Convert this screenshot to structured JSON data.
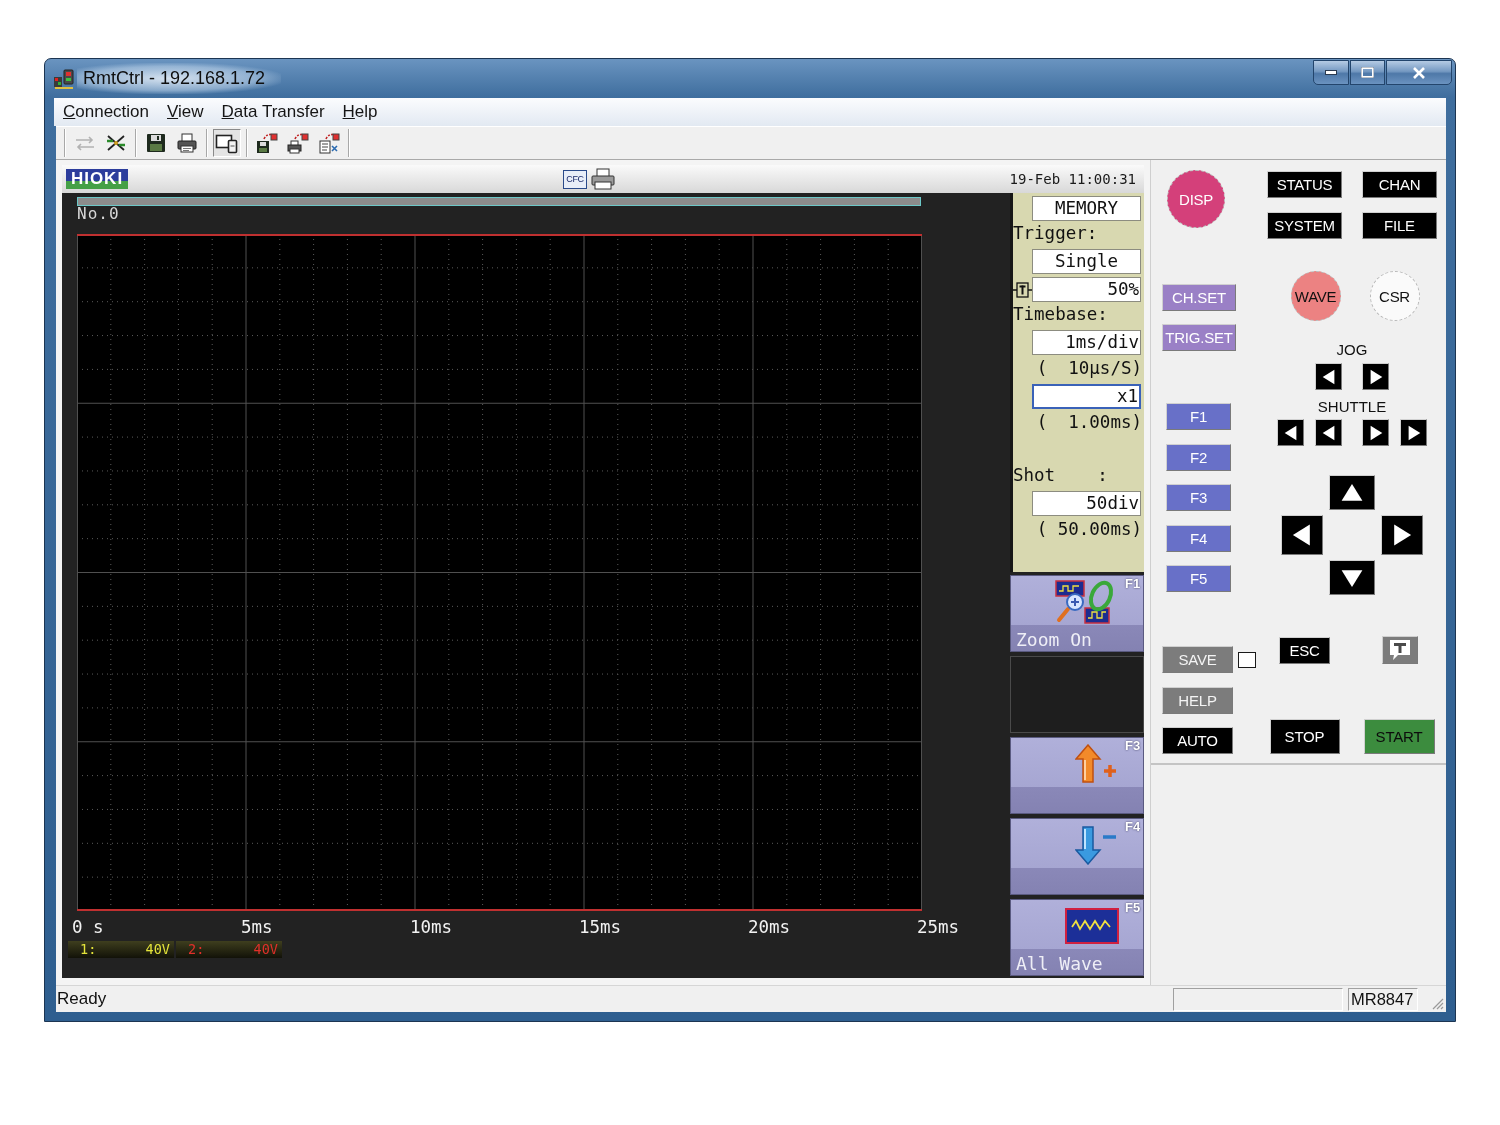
{
  "window": {
    "title": "RmtCtrl - 192.168.1.72"
  },
  "menu": [
    {
      "label": "Connection"
    },
    {
      "label": "View"
    },
    {
      "label": "Data Transfer"
    },
    {
      "label": "Help"
    }
  ],
  "toolbar": [
    {
      "disabled": true,
      "pressed": false
    },
    {
      "disabled": false,
      "pressed": false
    },
    {
      "disabled": false,
      "pressed": false
    },
    {
      "disabled": false,
      "pressed": false
    },
    {
      "disabled": false,
      "pressed": true
    },
    {
      "disabled": false,
      "pressed": false
    },
    {
      "disabled": false,
      "pressed": false
    },
    {
      "disabled": false,
      "pressed": false
    }
  ],
  "instrument": {
    "logo": "HIOKI",
    "media": "CFC",
    "datetime": "19-Feb 11:00:31",
    "record": "No.0",
    "time_axis": [
      "0 s",
      "5ms",
      "10ms",
      "15ms",
      "20ms",
      "25ms"
    ],
    "channels": [
      {
        "label": "1:",
        "range": "40V",
        "color": "#e4e43a"
      },
      {
        "label": "2:",
        "range": "40V",
        "color": "#e0302a"
      }
    ],
    "settings": [
      {
        "kind": "choice",
        "value": "MEMORY",
        "focused": false
      },
      {
        "kind": "label",
        "text": "Trigger:"
      },
      {
        "kind": "choice",
        "value": "Single",
        "focused": false
      },
      {
        "kind": "trigger",
        "value": "50%",
        "focused": false
      },
      {
        "kind": "label",
        "text": "Timebase:"
      },
      {
        "kind": "value",
        "value": "1ms/div",
        "focused": false
      },
      {
        "kind": "note",
        "text": "(  10μs/S)"
      },
      {
        "kind": "value",
        "value": "x1",
        "focused": true
      },
      {
        "kind": "note",
        "text": "(  1.00ms)"
      },
      {
        "kind": "spacer"
      },
      {
        "kind": "label",
        "text": "Shot    :"
      },
      {
        "kind": "value",
        "value": "50div",
        "focused": false
      },
      {
        "kind": "note",
        "text": "( 50.00ms)"
      }
    ],
    "softkeys": [
      {
        "kind": "key",
        "key": "F1",
        "label": "Zoom On"
      },
      {
        "kind": "blank"
      },
      {
        "kind": "key",
        "key": "F3"
      },
      {
        "kind": "key",
        "key": "F4"
      },
      {
        "kind": "key",
        "key": "F5",
        "label": "All Wave"
      }
    ]
  },
  "control_panel": {
    "round_keys": [
      {
        "label": "DISP",
        "color": "#d4407a"
      },
      {
        "label": "WAVE",
        "color": "#ec8282"
      },
      {
        "label": "CSR",
        "color": "#fafafa"
      }
    ],
    "menu_keys": [
      "STATUS",
      "CHAN",
      "SYSTEM",
      "FILE"
    ],
    "setup_keys": [
      "CH.SET",
      "TRIG.SET"
    ],
    "jog_label": "JOG",
    "shuttle_label": "SHUTTLE",
    "function_keys": [
      "F1",
      "F2",
      "F3",
      "F4",
      "F5"
    ],
    "save": {
      "label": "SAVE",
      "checked": false
    },
    "esc": "ESC",
    "help": "HELP",
    "auto": "AUTO",
    "stop": "STOP",
    "start": "START"
  },
  "status_bar": {
    "message": "Ready",
    "model": "MR8847"
  }
}
